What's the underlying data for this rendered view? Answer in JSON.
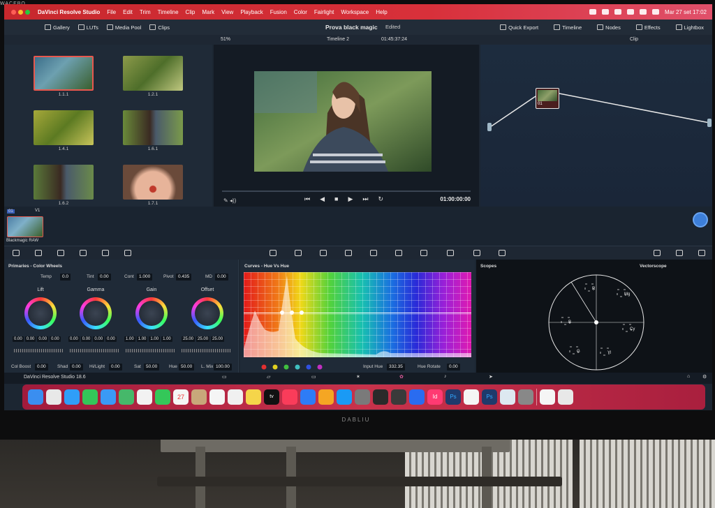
{
  "monitor": {
    "top_brand": "WACEBO",
    "bottom_brand": "DABLIU"
  },
  "menubar": {
    "app_name": "DaVinci Resolve Studio",
    "items": [
      "File",
      "Edit",
      "Trim",
      "Timeline",
      "Clip",
      "Mark",
      "View",
      "Playback",
      "Fusion",
      "Color",
      "Fairlight",
      "Workspace",
      "Help"
    ],
    "datetime": "Mar 27 set  17:02"
  },
  "toolbar": {
    "gallery": "Gallery",
    "luts": "LUTs",
    "media_pool": "Media Pool",
    "clips": "Clips",
    "project_title": "Prova black magic",
    "project_status": "Edited",
    "quick_export": "Quick Export",
    "timeline": "Timeline",
    "nodes": "Nodes",
    "effects": "Effects",
    "lightbox": "Lightbox"
  },
  "toolbar2": {
    "zoom": "51%",
    "timeline_name": "Timeline 2",
    "timecode": "01:45:37:24",
    "mode": "Clip"
  },
  "gallery": {
    "stills": [
      {
        "label": "1.1.1",
        "selected": true
      },
      {
        "label": "1.2.1",
        "selected": false
      },
      {
        "label": "1.4.1",
        "selected": false
      },
      {
        "label": "1.6.1",
        "selected": false
      },
      {
        "label": "1.6.2",
        "selected": false
      },
      {
        "label": "1.7.1",
        "selected": false
      }
    ]
  },
  "viewer": {
    "timecode": "01:00:00:00"
  },
  "nodes": {
    "node_label": "01"
  },
  "clip": {
    "number": "01",
    "track": "V1",
    "name": "Blackmagic RAW"
  },
  "primaries": {
    "title": "Primaries - Color Wheels",
    "temp": {
      "label": "Temp",
      "value": "0.0"
    },
    "tint": {
      "label": "Tint",
      "value": "0.00"
    },
    "cont": {
      "label": "Cont",
      "value": "1.000"
    },
    "pivot": {
      "label": "Pivot",
      "value": "0.435"
    },
    "md": {
      "label": "MD",
      "value": "0.00"
    },
    "wheels": [
      {
        "name": "Lift",
        "values": [
          "0.00",
          "0.00",
          "0.00",
          "0.00"
        ]
      },
      {
        "name": "Gamma",
        "values": [
          "0.00",
          "0.00",
          "0.00",
          "0.00"
        ]
      },
      {
        "name": "Gain",
        "values": [
          "1.00",
          "1.00",
          "1.00",
          "1.00"
        ]
      },
      {
        "name": "Offset",
        "values": [
          "25.00",
          "25.00",
          "25.00"
        ]
      }
    ],
    "col_boost": {
      "label": "Col Boost",
      "value": "0.00"
    },
    "shad": {
      "label": "Shad",
      "value": "0.00"
    },
    "hilight": {
      "label": "Hi/Light",
      "value": "0.00"
    },
    "sat": {
      "label": "Sat",
      "value": "50.00"
    },
    "hue": {
      "label": "Hue",
      "value": "50.00"
    },
    "lmix": {
      "label": "L. Mix",
      "value": "100.00"
    }
  },
  "curves": {
    "title": "Curves - Hue Vs Hue",
    "input_hue": {
      "label": "Input Hue",
      "value": "332.35"
    },
    "hue_rotate": {
      "label": "Hue Rotate",
      "value": "0.00"
    },
    "swatch_colors": [
      "#e23030",
      "#e0d020",
      "#40c040",
      "#40c0c0",
      "#3050e0",
      "#c030c0"
    ]
  },
  "scopes": {
    "title": "Scopes",
    "type": "Vectorscope",
    "targets": [
      "R",
      "Mg",
      "B",
      "Cy",
      "G",
      "Yl"
    ]
  },
  "statusbar": {
    "app": "DaVinci Resolve Studio 18.6"
  },
  "dock": {
    "icons": [
      "finder-icon",
      "launchpad-icon",
      "safari-icon",
      "messages-icon",
      "mail-icon",
      "maps-icon",
      "photos-icon",
      "facetime-icon",
      "calendar-icon",
      "contacts-icon",
      "reminders-icon",
      "chrome-icon",
      "notes-icon",
      "tv-icon",
      "music-icon",
      "keynote-icon",
      "pages-icon",
      "app-store-icon",
      "settings-icon",
      "davinci-icon",
      "final-cut-icon",
      "xcode-icon",
      "indesign-icon",
      "photoshop-icon",
      "vmware-icon",
      "photoshop-2-icon",
      "quicktime-icon",
      "calculator-icon",
      "document-icon",
      "trash-icon"
    ],
    "calendar_day": "27",
    "tv_label": "tv",
    "indesign_label": "Id",
    "photoshop_label": "Ps"
  }
}
